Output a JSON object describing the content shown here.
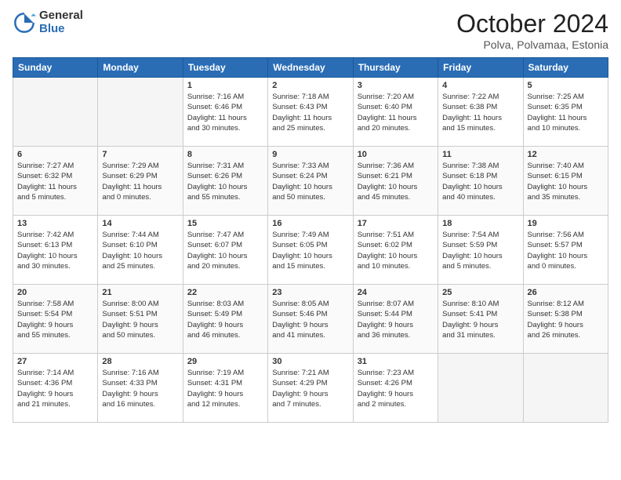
{
  "logo": {
    "general": "General",
    "blue": "Blue"
  },
  "title": "October 2024",
  "subtitle": "Polva, Polvamaa, Estonia",
  "headers": [
    "Sunday",
    "Monday",
    "Tuesday",
    "Wednesday",
    "Thursday",
    "Friday",
    "Saturday"
  ],
  "weeks": [
    [
      {
        "day": "",
        "info": ""
      },
      {
        "day": "",
        "info": ""
      },
      {
        "day": "1",
        "info": "Sunrise: 7:16 AM\nSunset: 6:46 PM\nDaylight: 11 hours\nand 30 minutes."
      },
      {
        "day": "2",
        "info": "Sunrise: 7:18 AM\nSunset: 6:43 PM\nDaylight: 11 hours\nand 25 minutes."
      },
      {
        "day": "3",
        "info": "Sunrise: 7:20 AM\nSunset: 6:40 PM\nDaylight: 11 hours\nand 20 minutes."
      },
      {
        "day": "4",
        "info": "Sunrise: 7:22 AM\nSunset: 6:38 PM\nDaylight: 11 hours\nand 15 minutes."
      },
      {
        "day": "5",
        "info": "Sunrise: 7:25 AM\nSunset: 6:35 PM\nDaylight: 11 hours\nand 10 minutes."
      }
    ],
    [
      {
        "day": "6",
        "info": "Sunrise: 7:27 AM\nSunset: 6:32 PM\nDaylight: 11 hours\nand 5 minutes."
      },
      {
        "day": "7",
        "info": "Sunrise: 7:29 AM\nSunset: 6:29 PM\nDaylight: 11 hours\nand 0 minutes."
      },
      {
        "day": "8",
        "info": "Sunrise: 7:31 AM\nSunset: 6:26 PM\nDaylight: 10 hours\nand 55 minutes."
      },
      {
        "day": "9",
        "info": "Sunrise: 7:33 AM\nSunset: 6:24 PM\nDaylight: 10 hours\nand 50 minutes."
      },
      {
        "day": "10",
        "info": "Sunrise: 7:36 AM\nSunset: 6:21 PM\nDaylight: 10 hours\nand 45 minutes."
      },
      {
        "day": "11",
        "info": "Sunrise: 7:38 AM\nSunset: 6:18 PM\nDaylight: 10 hours\nand 40 minutes."
      },
      {
        "day": "12",
        "info": "Sunrise: 7:40 AM\nSunset: 6:15 PM\nDaylight: 10 hours\nand 35 minutes."
      }
    ],
    [
      {
        "day": "13",
        "info": "Sunrise: 7:42 AM\nSunset: 6:13 PM\nDaylight: 10 hours\nand 30 minutes."
      },
      {
        "day": "14",
        "info": "Sunrise: 7:44 AM\nSunset: 6:10 PM\nDaylight: 10 hours\nand 25 minutes."
      },
      {
        "day": "15",
        "info": "Sunrise: 7:47 AM\nSunset: 6:07 PM\nDaylight: 10 hours\nand 20 minutes."
      },
      {
        "day": "16",
        "info": "Sunrise: 7:49 AM\nSunset: 6:05 PM\nDaylight: 10 hours\nand 15 minutes."
      },
      {
        "day": "17",
        "info": "Sunrise: 7:51 AM\nSunset: 6:02 PM\nDaylight: 10 hours\nand 10 minutes."
      },
      {
        "day": "18",
        "info": "Sunrise: 7:54 AM\nSunset: 5:59 PM\nDaylight: 10 hours\nand 5 minutes."
      },
      {
        "day": "19",
        "info": "Sunrise: 7:56 AM\nSunset: 5:57 PM\nDaylight: 10 hours\nand 0 minutes."
      }
    ],
    [
      {
        "day": "20",
        "info": "Sunrise: 7:58 AM\nSunset: 5:54 PM\nDaylight: 9 hours\nand 55 minutes."
      },
      {
        "day": "21",
        "info": "Sunrise: 8:00 AM\nSunset: 5:51 PM\nDaylight: 9 hours\nand 50 minutes."
      },
      {
        "day": "22",
        "info": "Sunrise: 8:03 AM\nSunset: 5:49 PM\nDaylight: 9 hours\nand 46 minutes."
      },
      {
        "day": "23",
        "info": "Sunrise: 8:05 AM\nSunset: 5:46 PM\nDaylight: 9 hours\nand 41 minutes."
      },
      {
        "day": "24",
        "info": "Sunrise: 8:07 AM\nSunset: 5:44 PM\nDaylight: 9 hours\nand 36 minutes."
      },
      {
        "day": "25",
        "info": "Sunrise: 8:10 AM\nSunset: 5:41 PM\nDaylight: 9 hours\nand 31 minutes."
      },
      {
        "day": "26",
        "info": "Sunrise: 8:12 AM\nSunset: 5:38 PM\nDaylight: 9 hours\nand 26 minutes."
      }
    ],
    [
      {
        "day": "27",
        "info": "Sunrise: 7:14 AM\nSunset: 4:36 PM\nDaylight: 9 hours\nand 21 minutes."
      },
      {
        "day": "28",
        "info": "Sunrise: 7:16 AM\nSunset: 4:33 PM\nDaylight: 9 hours\nand 16 minutes."
      },
      {
        "day": "29",
        "info": "Sunrise: 7:19 AM\nSunset: 4:31 PM\nDaylight: 9 hours\nand 12 minutes."
      },
      {
        "day": "30",
        "info": "Sunrise: 7:21 AM\nSunset: 4:29 PM\nDaylight: 9 hours\nand 7 minutes."
      },
      {
        "day": "31",
        "info": "Sunrise: 7:23 AM\nSunset: 4:26 PM\nDaylight: 9 hours\nand 2 minutes."
      },
      {
        "day": "",
        "info": ""
      },
      {
        "day": "",
        "info": ""
      }
    ]
  ]
}
